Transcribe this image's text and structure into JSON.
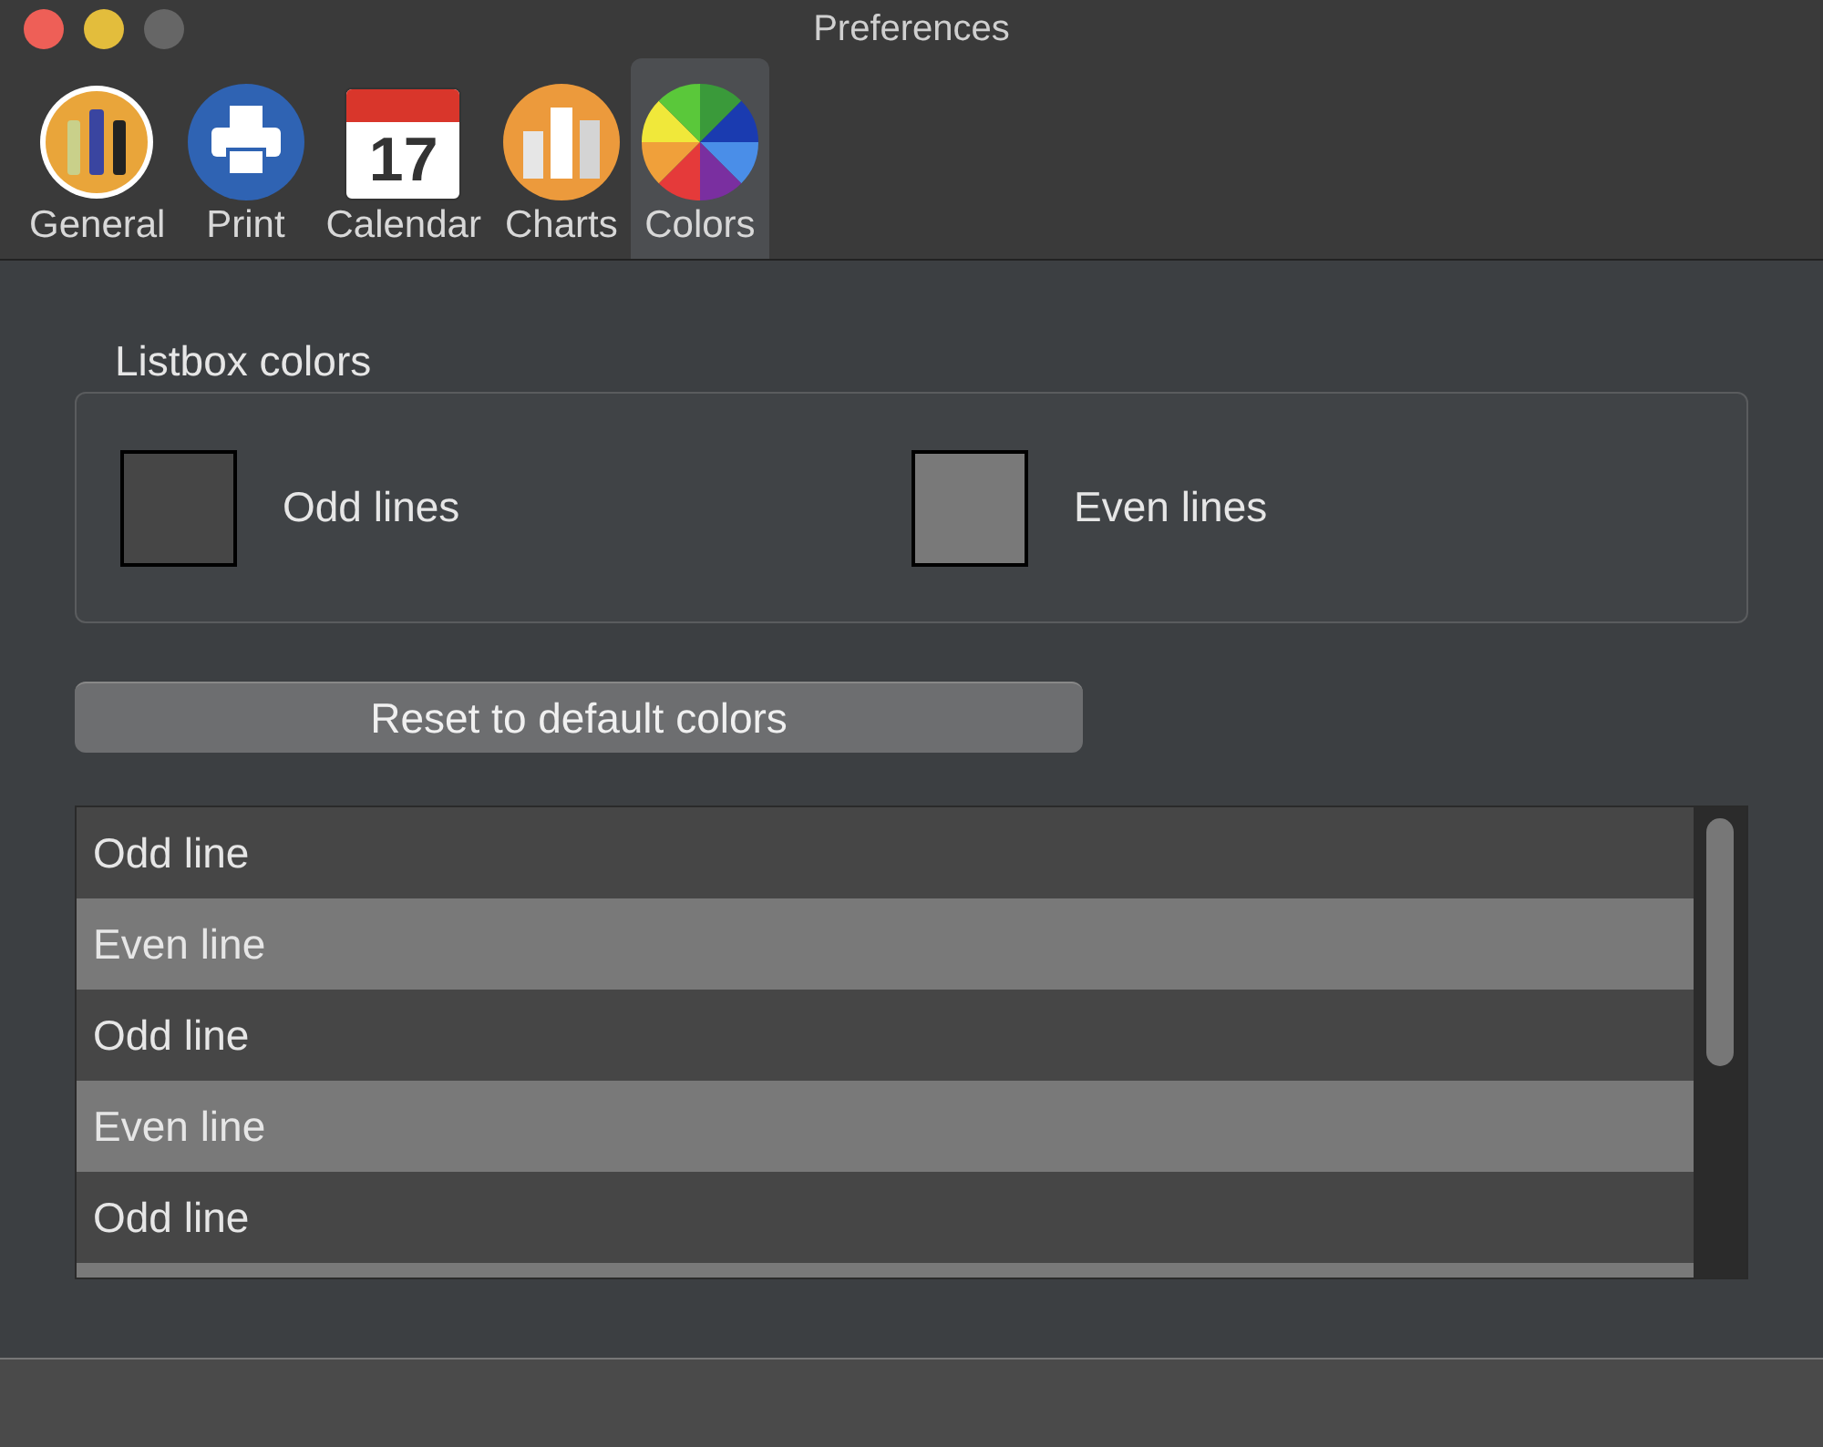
{
  "window": {
    "title": "Preferences"
  },
  "tabs": [
    {
      "label": "General",
      "kind": "bottles",
      "selected": false
    },
    {
      "label": "Print",
      "kind": "printer",
      "selected": false
    },
    {
      "label": "Calendar",
      "kind": "calendar",
      "icon_text": "17",
      "selected": false
    },
    {
      "label": "Charts",
      "kind": "chart",
      "selected": false
    },
    {
      "label": "Colors",
      "kind": "wheel",
      "selected": true
    }
  ],
  "listbox_colors": {
    "title": "Listbox colors",
    "swatches": [
      {
        "label": "Odd lines",
        "color": "#464646"
      },
      {
        "label": "Even lines",
        "color": "#797979"
      }
    ]
  },
  "reset_button": "Reset to default colors",
  "list": {
    "rows": [
      {
        "text": "Odd line",
        "kind": "odd"
      },
      {
        "text": "Even line",
        "kind": "even"
      },
      {
        "text": "Odd line",
        "kind": "odd"
      },
      {
        "text": "Even line",
        "kind": "even"
      },
      {
        "text": "Odd line",
        "kind": "odd"
      }
    ]
  }
}
